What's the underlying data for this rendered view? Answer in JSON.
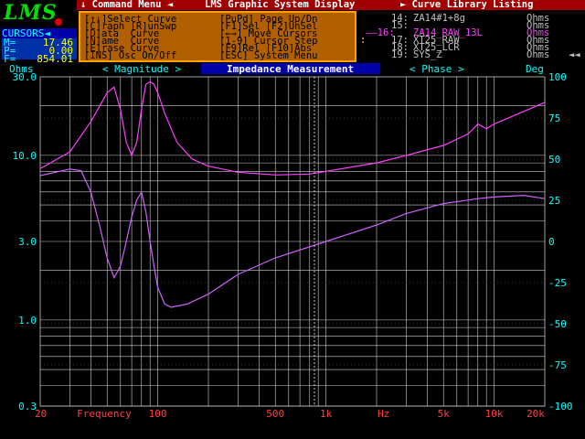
{
  "logo": {
    "text": "LMS"
  },
  "title": {
    "command_menu": "↓ Command Menu ◄",
    "system": "LMS Graphic System Display",
    "library": "► Curve Library Listing"
  },
  "cursors": {
    "heading": "CURSORS◄",
    "m_label": "M=",
    "m_value": "17.46",
    "p_label": "P=",
    "p_value": "0.00",
    "f_label": "F=",
    "f_value": "854.01"
  },
  "commands": [
    "[↑↓]Select Curve",
    "[C]raph [R]unSwp",
    "[D]ata  Curve",
    "[N]ame  Curve",
    "[E]rase Curve",
    "[INS] Osc On/Off",
    "[PuPd] Page Up/Dn",
    "[F1]Sel [F2]UnSel",
    "[←→] Move Cursors",
    "[1-9] Cursor Step",
    "[F9]Rel [F10]Abs",
    "[ESC] System Menu"
  ],
  "library": [
    {
      "num": "14:",
      "name": "ZA14#1+8g",
      "unit": "Ohms",
      "selected": false
    },
    {
      "num": "15:",
      "name": "",
      "unit": "Ohms",
      "selected": false
    },
    {
      "num": "——16:",
      "name": "ZA14_RAW_13L",
      "unit": "Ohms",
      "selected": true
    },
    {
      "num": "17:",
      "name": "XT25_RAW",
      "unit": "Ohms",
      "selected": false
    },
    {
      "num": "18:",
      "name": "XT25_LCR",
      "unit": "Ohms",
      "selected": false
    },
    {
      "num": "19:",
      "name": "SYS_Z",
      "unit": "Ohms",
      "selected": false
    }
  ],
  "header": {
    "left_unit": "Ohms",
    "magnitude": "< Magnitude >",
    "title": "Impedance Measurement",
    "phase": "< Phase >",
    "right_unit": "Deg"
  },
  "chart_data": {
    "type": "line",
    "title": "Impedance Measurement",
    "xlabel": "Frequency",
    "x_scale": "log",
    "xlim": [
      20,
      20000
    ],
    "x_ticks": [
      "20",
      "Frequency",
      "100",
      "500",
      "1k",
      "Hz",
      "5k",
      "10k",
      "20k"
    ],
    "y_left": {
      "label": "Ohms",
      "scale": "log",
      "lim": [
        0.3,
        30
      ],
      "ticks": [
        "30.0",
        "10.0",
        "3.0",
        "1.0",
        "0.3"
      ]
    },
    "y_right": {
      "label": "Deg",
      "lim": [
        -100,
        100
      ],
      "ticks": [
        "100",
        "75",
        "50",
        "25",
        "0",
        "-25",
        "-50",
        "-75",
        "-100"
      ]
    },
    "grid": true,
    "series": [
      {
        "name": "Magnitude",
        "axis": "left",
        "color": "#ff40ff",
        "x": [
          20,
          30,
          40,
          50,
          55,
          60,
          65,
          70,
          75,
          80,
          85,
          90,
          95,
          100,
          110,
          130,
          160,
          200,
          300,
          500,
          800,
          1000,
          2000,
          3000,
          5000,
          7000,
          8000,
          9000,
          10000,
          15000,
          20000
        ],
        "y": [
          8.3,
          10.5,
          16,
          24,
          26,
          19,
          12,
          10,
          12,
          19,
          27,
          28,
          27,
          24,
          18,
          12,
          9.5,
          8.6,
          7.9,
          7.6,
          7.7,
          8.0,
          9.0,
          10.0,
          11.5,
          13.5,
          15.5,
          14.5,
          15.5,
          18.5,
          21
        ]
      },
      {
        "name": "Phase",
        "axis": "right",
        "color": "#d060ff",
        "x": [
          20,
          30,
          35,
          40,
          45,
          50,
          55,
          60,
          65,
          70,
          75,
          80,
          85,
          90,
          95,
          100,
          110,
          120,
          150,
          200,
          300,
          500,
          1000,
          2000,
          3000,
          5000,
          8000,
          10000,
          15000,
          20000
        ],
        "y": [
          40,
          44,
          43,
          30,
          10,
          -10,
          -22,
          -15,
          0,
          15,
          25,
          30,
          18,
          0,
          -15,
          -28,
          -38,
          -40,
          -38,
          -32,
          -20,
          -10,
          0,
          10,
          17,
          23,
          26,
          27,
          28,
          26
        ]
      }
    ]
  }
}
